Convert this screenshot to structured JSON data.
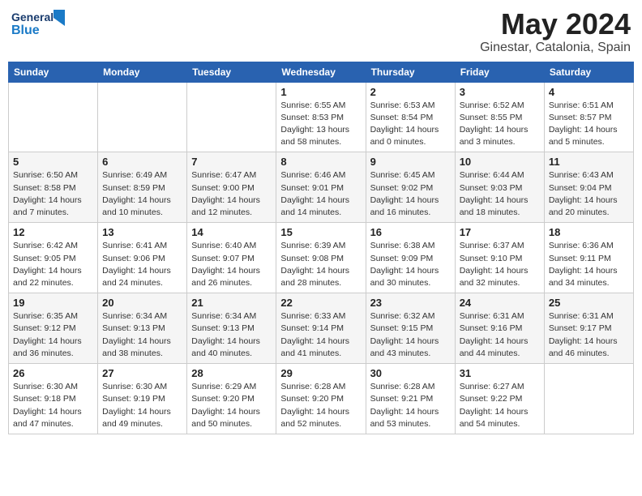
{
  "header": {
    "logo_line1": "General",
    "logo_line2": "Blue",
    "title": "May 2024",
    "subtitle": "Ginestar, Catalonia, Spain"
  },
  "weekdays": [
    "Sunday",
    "Monday",
    "Tuesday",
    "Wednesday",
    "Thursday",
    "Friday",
    "Saturday"
  ],
  "weeks": [
    [
      {
        "day": "",
        "info": ""
      },
      {
        "day": "",
        "info": ""
      },
      {
        "day": "",
        "info": ""
      },
      {
        "day": "1",
        "info": "Sunrise: 6:55 AM\nSunset: 8:53 PM\nDaylight: 13 hours\nand 58 minutes."
      },
      {
        "day": "2",
        "info": "Sunrise: 6:53 AM\nSunset: 8:54 PM\nDaylight: 14 hours\nand 0 minutes."
      },
      {
        "day": "3",
        "info": "Sunrise: 6:52 AM\nSunset: 8:55 PM\nDaylight: 14 hours\nand 3 minutes."
      },
      {
        "day": "4",
        "info": "Sunrise: 6:51 AM\nSunset: 8:57 PM\nDaylight: 14 hours\nand 5 minutes."
      }
    ],
    [
      {
        "day": "5",
        "info": "Sunrise: 6:50 AM\nSunset: 8:58 PM\nDaylight: 14 hours\nand 7 minutes."
      },
      {
        "day": "6",
        "info": "Sunrise: 6:49 AM\nSunset: 8:59 PM\nDaylight: 14 hours\nand 10 minutes."
      },
      {
        "day": "7",
        "info": "Sunrise: 6:47 AM\nSunset: 9:00 PM\nDaylight: 14 hours\nand 12 minutes."
      },
      {
        "day": "8",
        "info": "Sunrise: 6:46 AM\nSunset: 9:01 PM\nDaylight: 14 hours\nand 14 minutes."
      },
      {
        "day": "9",
        "info": "Sunrise: 6:45 AM\nSunset: 9:02 PM\nDaylight: 14 hours\nand 16 minutes."
      },
      {
        "day": "10",
        "info": "Sunrise: 6:44 AM\nSunset: 9:03 PM\nDaylight: 14 hours\nand 18 minutes."
      },
      {
        "day": "11",
        "info": "Sunrise: 6:43 AM\nSunset: 9:04 PM\nDaylight: 14 hours\nand 20 minutes."
      }
    ],
    [
      {
        "day": "12",
        "info": "Sunrise: 6:42 AM\nSunset: 9:05 PM\nDaylight: 14 hours\nand 22 minutes."
      },
      {
        "day": "13",
        "info": "Sunrise: 6:41 AM\nSunset: 9:06 PM\nDaylight: 14 hours\nand 24 minutes."
      },
      {
        "day": "14",
        "info": "Sunrise: 6:40 AM\nSunset: 9:07 PM\nDaylight: 14 hours\nand 26 minutes."
      },
      {
        "day": "15",
        "info": "Sunrise: 6:39 AM\nSunset: 9:08 PM\nDaylight: 14 hours\nand 28 minutes."
      },
      {
        "day": "16",
        "info": "Sunrise: 6:38 AM\nSunset: 9:09 PM\nDaylight: 14 hours\nand 30 minutes."
      },
      {
        "day": "17",
        "info": "Sunrise: 6:37 AM\nSunset: 9:10 PM\nDaylight: 14 hours\nand 32 minutes."
      },
      {
        "day": "18",
        "info": "Sunrise: 6:36 AM\nSunset: 9:11 PM\nDaylight: 14 hours\nand 34 minutes."
      }
    ],
    [
      {
        "day": "19",
        "info": "Sunrise: 6:35 AM\nSunset: 9:12 PM\nDaylight: 14 hours\nand 36 minutes."
      },
      {
        "day": "20",
        "info": "Sunrise: 6:34 AM\nSunset: 9:13 PM\nDaylight: 14 hours\nand 38 minutes."
      },
      {
        "day": "21",
        "info": "Sunrise: 6:34 AM\nSunset: 9:13 PM\nDaylight: 14 hours\nand 40 minutes."
      },
      {
        "day": "22",
        "info": "Sunrise: 6:33 AM\nSunset: 9:14 PM\nDaylight: 14 hours\nand 41 minutes."
      },
      {
        "day": "23",
        "info": "Sunrise: 6:32 AM\nSunset: 9:15 PM\nDaylight: 14 hours\nand 43 minutes."
      },
      {
        "day": "24",
        "info": "Sunrise: 6:31 AM\nSunset: 9:16 PM\nDaylight: 14 hours\nand 44 minutes."
      },
      {
        "day": "25",
        "info": "Sunrise: 6:31 AM\nSunset: 9:17 PM\nDaylight: 14 hours\nand 46 minutes."
      }
    ],
    [
      {
        "day": "26",
        "info": "Sunrise: 6:30 AM\nSunset: 9:18 PM\nDaylight: 14 hours\nand 47 minutes."
      },
      {
        "day": "27",
        "info": "Sunrise: 6:30 AM\nSunset: 9:19 PM\nDaylight: 14 hours\nand 49 minutes."
      },
      {
        "day": "28",
        "info": "Sunrise: 6:29 AM\nSunset: 9:20 PM\nDaylight: 14 hours\nand 50 minutes."
      },
      {
        "day": "29",
        "info": "Sunrise: 6:28 AM\nSunset: 9:20 PM\nDaylight: 14 hours\nand 52 minutes."
      },
      {
        "day": "30",
        "info": "Sunrise: 6:28 AM\nSunset: 9:21 PM\nDaylight: 14 hours\nand 53 minutes."
      },
      {
        "day": "31",
        "info": "Sunrise: 6:27 AM\nSunset: 9:22 PM\nDaylight: 14 hours\nand 54 minutes."
      },
      {
        "day": "",
        "info": ""
      }
    ]
  ]
}
